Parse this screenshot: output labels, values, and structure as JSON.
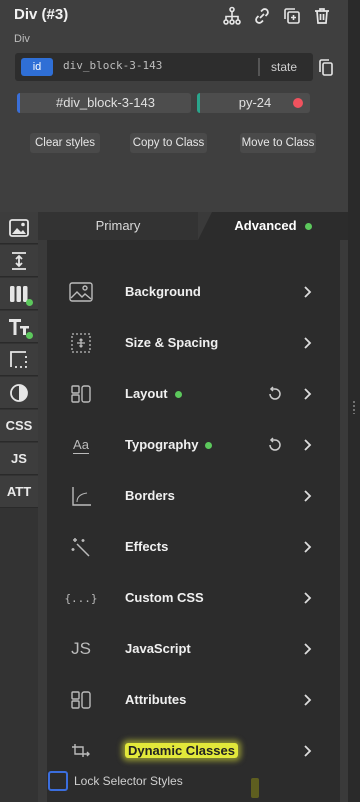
{
  "element": {
    "title": "Div (#3)",
    "type_label": "Div"
  },
  "header_icons": [
    "hierarchy-icon",
    "link-icon",
    "duplicate-icon",
    "trash-icon"
  ],
  "selector": {
    "type_badge": "id",
    "value": "div_block-3-143",
    "state_label": "state"
  },
  "classes": [
    {
      "label": "#div_block-3-143",
      "color": "#3a6fd8"
    },
    {
      "label": "py-24",
      "color": "#2aa58c",
      "status_color": "#f0525e"
    }
  ],
  "actions": {
    "clear": "Clear styles",
    "copy": "Copy to Class",
    "move": "Move to Class"
  },
  "sidebar": {
    "items": [
      {
        "name": "image-icon",
        "label": ""
      },
      {
        "name": "vertical-spacing-icon",
        "label": ""
      },
      {
        "name": "layout-icon",
        "label": "",
        "active_dot": true
      },
      {
        "name": "typography-icon",
        "label": "",
        "active_dot": true
      },
      {
        "name": "borders-icon",
        "label": ""
      },
      {
        "name": "contrast-icon",
        "label": ""
      },
      {
        "name": "css-tab",
        "label": "CSS"
      },
      {
        "name": "js-tab",
        "label": "JS"
      },
      {
        "name": "att-tab",
        "label": "ATT"
      }
    ]
  },
  "tabs": {
    "primary": "Primary",
    "advanced": "Advanced"
  },
  "sections": [
    {
      "label": "Background",
      "icon": "background-icon",
      "dot": false,
      "reset": false
    },
    {
      "label": "Size & Spacing",
      "icon": "size-spacing-icon",
      "dot": false,
      "reset": false
    },
    {
      "label": "Layout",
      "icon": "layout-icon",
      "dot": true,
      "reset": true
    },
    {
      "label": "Typography",
      "icon": "typography-icon",
      "icon_text": "Aa",
      "dot": true,
      "reset": true
    },
    {
      "label": "Borders",
      "icon": "borders-icon",
      "dot": false,
      "reset": false
    },
    {
      "label": "Effects",
      "icon": "effects-icon",
      "dot": false,
      "reset": false
    },
    {
      "label": "Custom CSS",
      "icon": "custom-css-icon",
      "icon_text": "{...}",
      "dot": false,
      "reset": false
    },
    {
      "label": "JavaScript",
      "icon": "javascript-icon",
      "icon_text": "JS",
      "dot": false,
      "reset": false
    },
    {
      "label": "Attributes",
      "icon": "attributes-icon",
      "dot": false,
      "reset": false
    },
    {
      "label": "Dynamic Classes",
      "icon": "dynamic-classes-icon",
      "dot": false,
      "reset": false,
      "highlighted": true
    }
  ],
  "lock": {
    "label": "Lock Selector Styles"
  },
  "colors": {
    "accent_blue": "#2f6fd6",
    "active_green": "#5cc85c",
    "highlight_yellow": "#e2e83a"
  }
}
